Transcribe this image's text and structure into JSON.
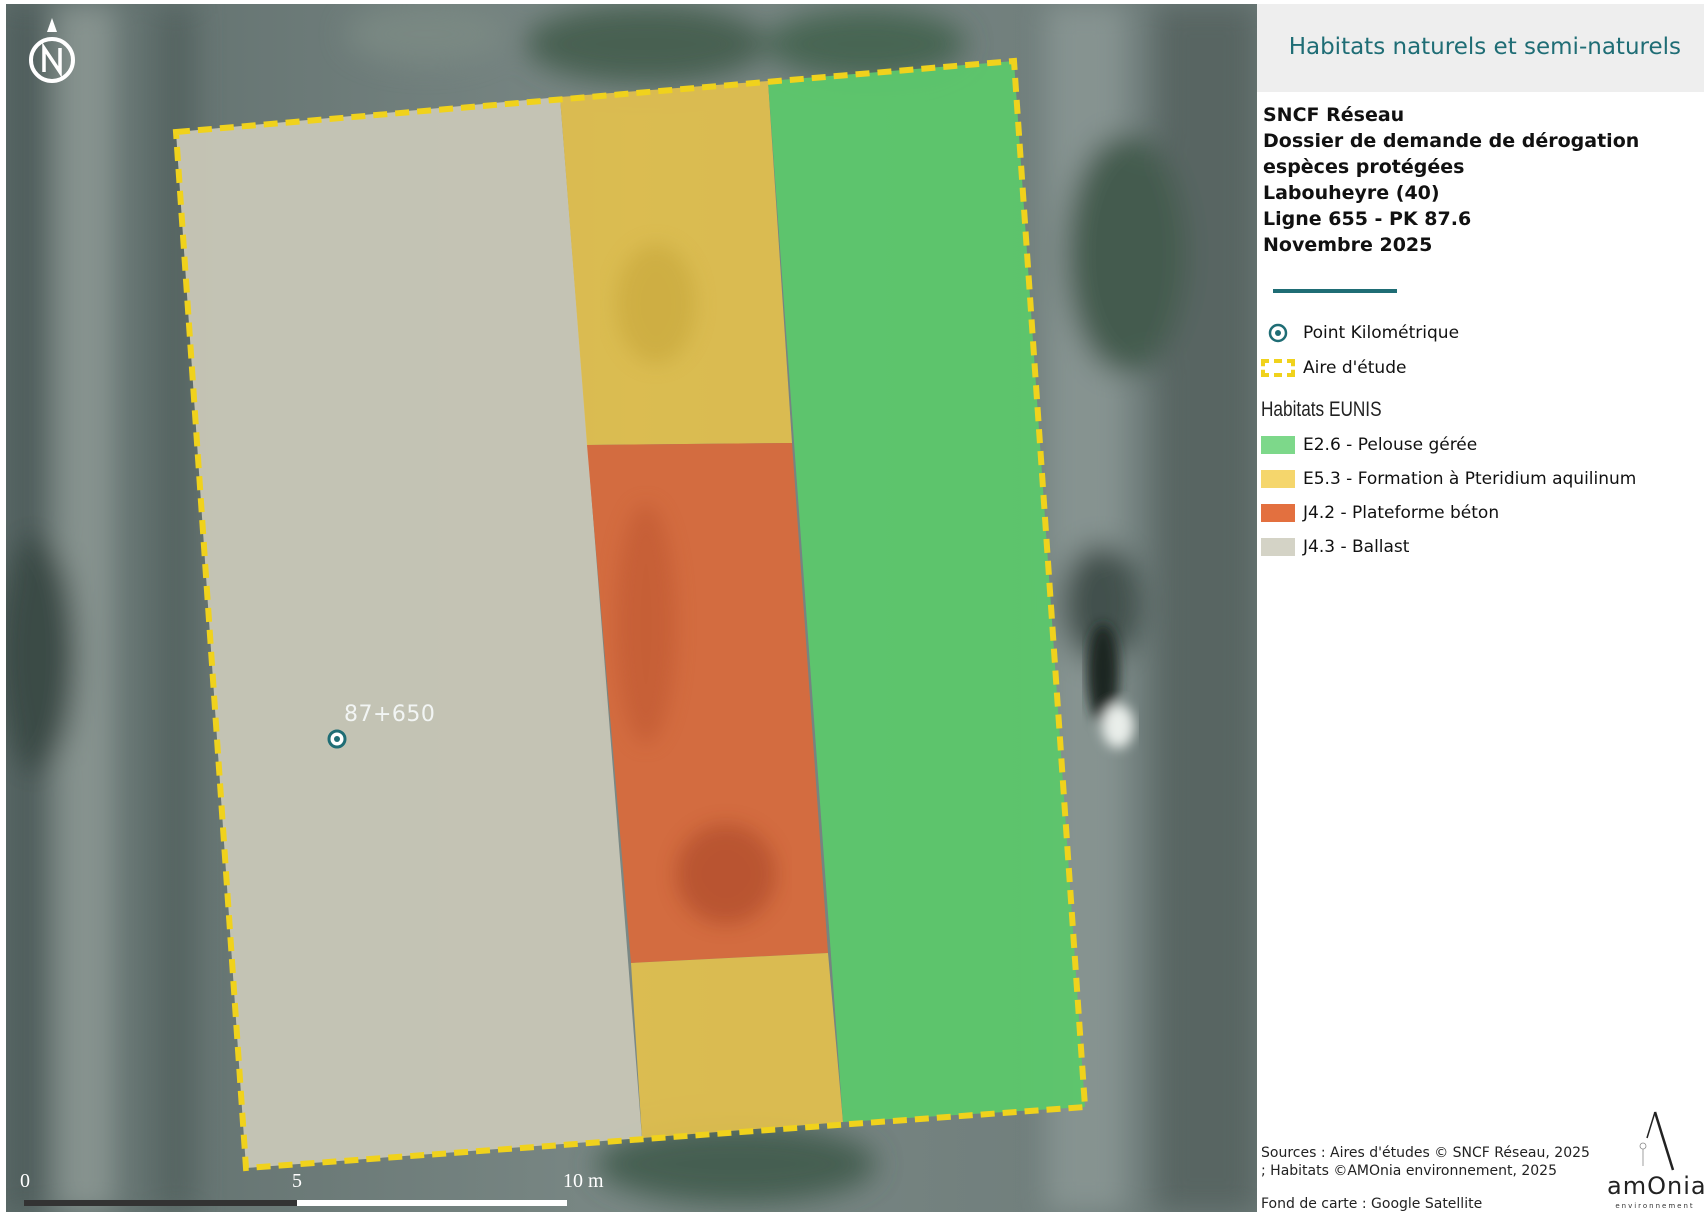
{
  "map": {
    "pk_label": "87+650",
    "north_icon": "north-arrow-icon",
    "scale": {
      "labels": [
        "0",
        "5",
        "10 m"
      ]
    },
    "colors": {
      "pelouse": "#5dc86a",
      "pteridium": "#e6c24f",
      "beton": "#dd6a3c",
      "ballast": "#c7c6b7",
      "study_outline": "#f0d21c",
      "pk_symbol": "#1f6d75"
    }
  },
  "panel": {
    "title": "Habitats naturels et semi-naturels",
    "meta": [
      "SNCF Réseau",
      "Dossier de demande de dérogation espèces protégées",
      "Labouheyre (40)",
      "Ligne 655 - PK 87.6",
      "Novembre 2025"
    ],
    "legend": {
      "point": "Point Kilométrique",
      "aire": "Aire d'étude",
      "habitats_heading": "Habitats EUNIS",
      "habitats": [
        {
          "label": "E2.6 - Pelouse gérée",
          "color": "#7dd88a"
        },
        {
          "label": "E5.3 - Formation à Pteridium aquilinum",
          "color": "#f5d66c"
        },
        {
          "label": "J4.2 - Plateforme béton",
          "color": "#e3703f"
        },
        {
          "label": "J4.3 - Ballast",
          "color": "#d4d3c6"
        }
      ]
    },
    "sources": "Sources : Aires d'études © SNCF Réseau, 2025 ; Habitats ©AMOnia environnement, 2025",
    "fond": "Fond de carte : Google Satellite",
    "logo": {
      "word": "amOnia",
      "sub": "environnement"
    }
  }
}
